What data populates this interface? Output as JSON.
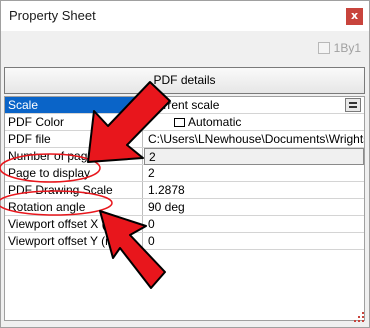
{
  "window": {
    "title": "Property Sheet",
    "close_label": "x"
  },
  "toolbar": {
    "checkbox_label": "1By1",
    "checkbox_checked": false
  },
  "tab": {
    "label": "PDF details"
  },
  "properties": [
    {
      "name": "Scale",
      "value": "Current scale"
    },
    {
      "name": "PDF Color",
      "value": "Automatic"
    },
    {
      "name": "PDF file",
      "value": "C:\\Users\\LNewhouse\\Documents\\Wrights"
    },
    {
      "name": "Number of pages",
      "value": "2"
    },
    {
      "name": "Page to display",
      "value": "2"
    },
    {
      "name": "PDF Drawing Scale",
      "value": "1.2878"
    },
    {
      "name": "Rotation angle",
      "value": "90 deg"
    },
    {
      "name": "Viewport offset X (in)",
      "value": "0"
    },
    {
      "name": "Viewport offset Y (in)",
      "value": "0"
    }
  ],
  "colors": {
    "selection": "#0a64c8",
    "annotation_red": "#e8161c",
    "close_button": "#c8443c"
  }
}
